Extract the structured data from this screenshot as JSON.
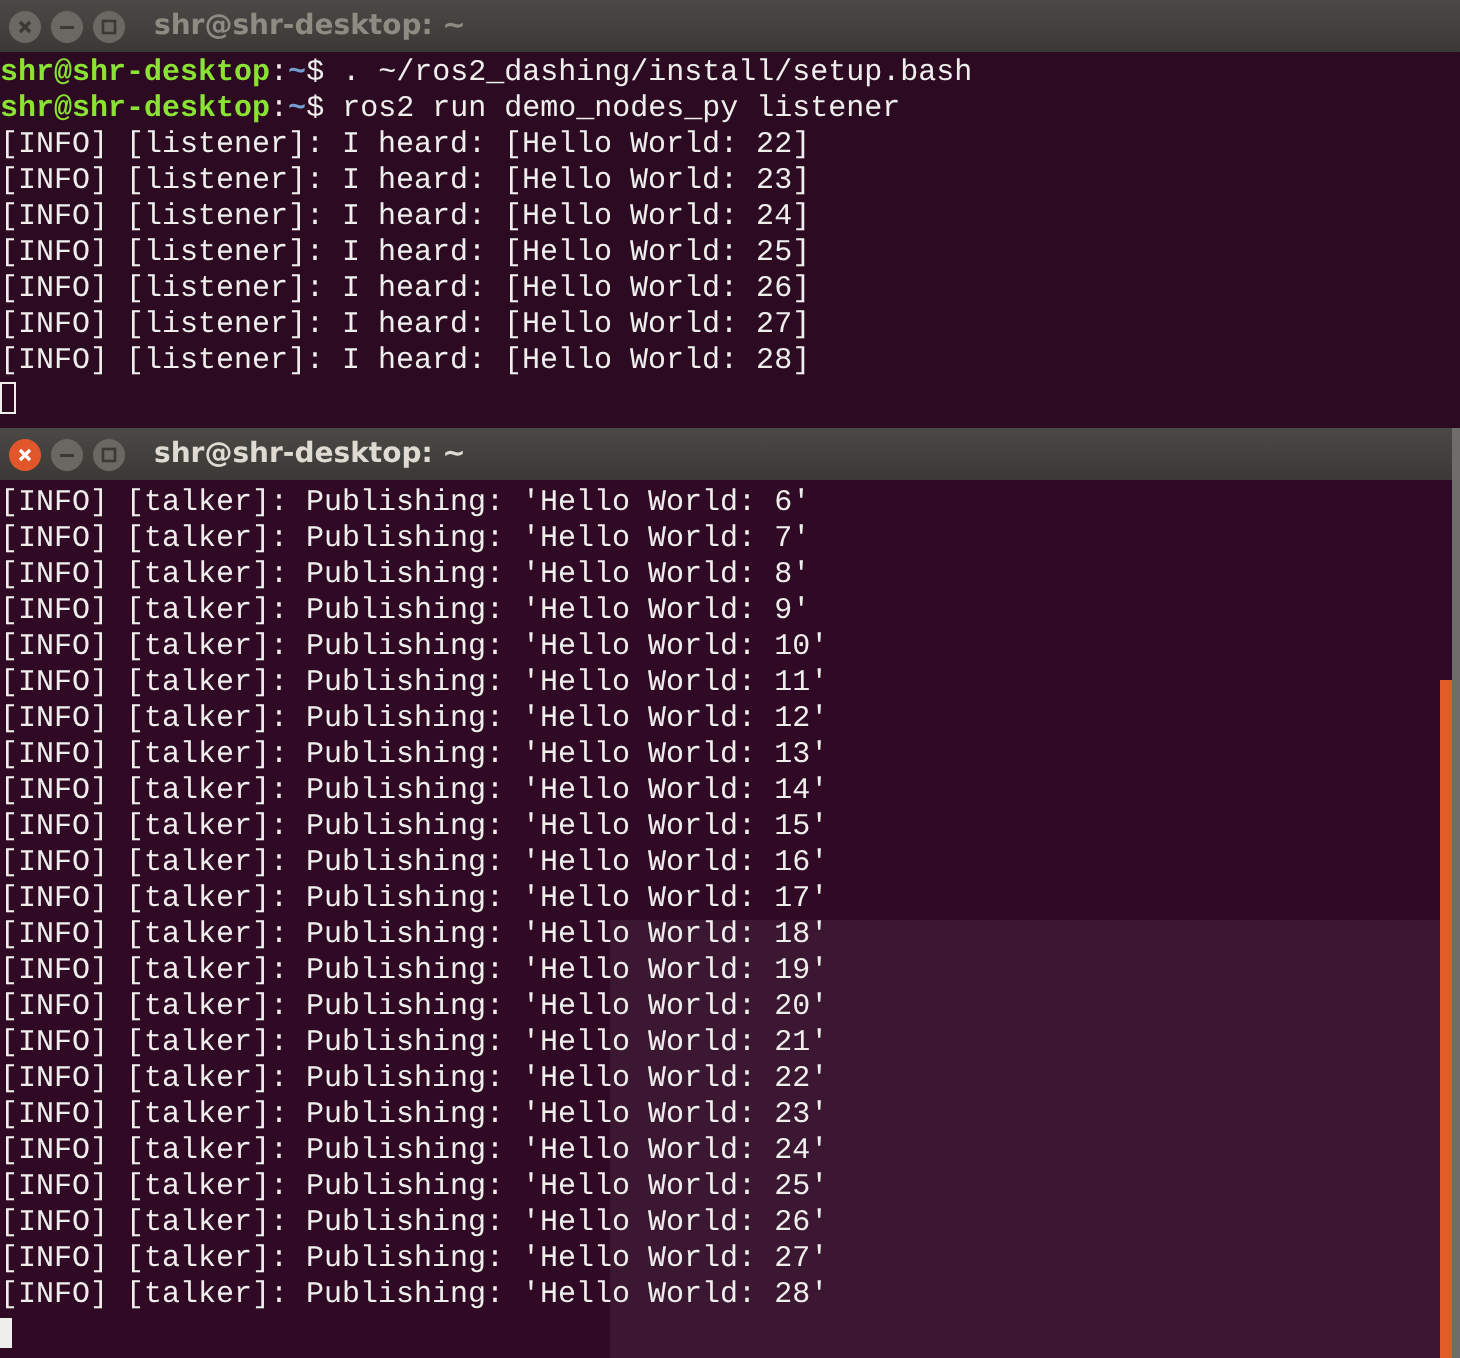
{
  "windows": [
    {
      "title": "shr@shr-desktop: ~",
      "focused": false,
      "lines": [
        {
          "segments": [
            {
              "kind": "user",
              "text": "shr@shr-desktop"
            },
            {
              "kind": "plain",
              "text": ":"
            },
            {
              "kind": "path",
              "text": "~"
            },
            {
              "kind": "plain",
              "text": "$ . ~/ros2_dashing/install/setup.bash"
            }
          ]
        },
        {
          "segments": [
            {
              "kind": "user",
              "text": "shr@shr-desktop"
            },
            {
              "kind": "plain",
              "text": ":"
            },
            {
              "kind": "path",
              "text": "~"
            },
            {
              "kind": "plain",
              "text": "$ ros2 run demo_nodes_py listener"
            }
          ]
        },
        {
          "segments": [
            {
              "kind": "plain",
              "text": "[INFO] [listener]: I heard: [Hello World: 22]"
            }
          ]
        },
        {
          "segments": [
            {
              "kind": "plain",
              "text": "[INFO] [listener]: I heard: [Hello World: 23]"
            }
          ]
        },
        {
          "segments": [
            {
              "kind": "plain",
              "text": "[INFO] [listener]: I heard: [Hello World: 24]"
            }
          ]
        },
        {
          "segments": [
            {
              "kind": "plain",
              "text": "[INFO] [listener]: I heard: [Hello World: 25]"
            }
          ]
        },
        {
          "segments": [
            {
              "kind": "plain",
              "text": "[INFO] [listener]: I heard: [Hello World: 26]"
            }
          ]
        },
        {
          "segments": [
            {
              "kind": "plain",
              "text": "[INFO] [listener]: I heard: [Hello World: 27]"
            }
          ]
        },
        {
          "segments": [
            {
              "kind": "plain",
              "text": "[INFO] [listener]: I heard: [Hello World: 28]"
            }
          ]
        }
      ]
    },
    {
      "title": "shr@shr-desktop: ~",
      "focused": true,
      "lines": [
        {
          "segments": [
            {
              "kind": "plain",
              "text": "[INFO] [talker]: Publishing: 'Hello World: 6'"
            }
          ]
        },
        {
          "segments": [
            {
              "kind": "plain",
              "text": "[INFO] [talker]: Publishing: 'Hello World: 7'"
            }
          ]
        },
        {
          "segments": [
            {
              "kind": "plain",
              "text": "[INFO] [talker]: Publishing: 'Hello World: 8'"
            }
          ]
        },
        {
          "segments": [
            {
              "kind": "plain",
              "text": "[INFO] [talker]: Publishing: 'Hello World: 9'"
            }
          ]
        },
        {
          "segments": [
            {
              "kind": "plain",
              "text": "[INFO] [talker]: Publishing: 'Hello World: 10'"
            }
          ]
        },
        {
          "segments": [
            {
              "kind": "plain",
              "text": "[INFO] [talker]: Publishing: 'Hello World: 11'"
            }
          ]
        },
        {
          "segments": [
            {
              "kind": "plain",
              "text": "[INFO] [talker]: Publishing: 'Hello World: 12'"
            }
          ]
        },
        {
          "segments": [
            {
              "kind": "plain",
              "text": "[INFO] [talker]: Publishing: 'Hello World: 13'"
            }
          ]
        },
        {
          "segments": [
            {
              "kind": "plain",
              "text": "[INFO] [talker]: Publishing: 'Hello World: 14'"
            }
          ]
        },
        {
          "segments": [
            {
              "kind": "plain",
              "text": "[INFO] [talker]: Publishing: 'Hello World: 15'"
            }
          ]
        },
        {
          "segments": [
            {
              "kind": "plain",
              "text": "[INFO] [talker]: Publishing: 'Hello World: 16'"
            }
          ]
        },
        {
          "segments": [
            {
              "kind": "plain",
              "text": "[INFO] [talker]: Publishing: 'Hello World: 17'"
            }
          ]
        },
        {
          "segments": [
            {
              "kind": "plain",
              "text": "[INFO] [talker]: Publishing: 'Hello World: 18'"
            }
          ]
        },
        {
          "segments": [
            {
              "kind": "plain",
              "text": "[INFO] [talker]: Publishing: 'Hello World: 19'"
            }
          ]
        },
        {
          "segments": [
            {
              "kind": "plain",
              "text": "[INFO] [talker]: Publishing: 'Hello World: 20'"
            }
          ]
        },
        {
          "segments": [
            {
              "kind": "plain",
              "text": "[INFO] [talker]: Publishing: 'Hello World: 21'"
            }
          ]
        },
        {
          "segments": [
            {
              "kind": "plain",
              "text": "[INFO] [talker]: Publishing: 'Hello World: 22'"
            }
          ]
        },
        {
          "segments": [
            {
              "kind": "plain",
              "text": "[INFO] [talker]: Publishing: 'Hello World: 23'"
            }
          ]
        },
        {
          "segments": [
            {
              "kind": "plain",
              "text": "[INFO] [talker]: Publishing: 'Hello World: 24'"
            }
          ]
        },
        {
          "segments": [
            {
              "kind": "plain",
              "text": "[INFO] [talker]: Publishing: 'Hello World: 25'"
            }
          ]
        },
        {
          "segments": [
            {
              "kind": "plain",
              "text": "[INFO] [talker]: Publishing: 'Hello World: 26'"
            }
          ]
        },
        {
          "segments": [
            {
              "kind": "plain",
              "text": "[INFO] [talker]: Publishing: 'Hello World: 27'"
            }
          ]
        },
        {
          "segments": [
            {
              "kind": "plain",
              "text": "[INFO] [talker]: Publishing: 'Hello World: 28'"
            }
          ]
        }
      ]
    }
  ]
}
